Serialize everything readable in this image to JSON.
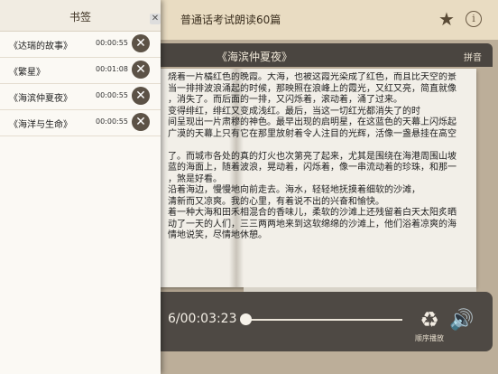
{
  "navbar": {
    "title": "普通话考试朗读60篇",
    "star_icon": "star-icon",
    "info_icon": "info-icon",
    "info_glyph": "i"
  },
  "book": {
    "title": "《海滨仲夏夜》",
    "pinyin_label": "拼音",
    "lines": [
      "烧着一片橘红色的晚霞。大海，也被这霞光染成了红色，而且比天空的景",
      "当一排排波浪涌起的时候，那映照在浪峰上的霞光，又红又亮，简直就像",
      "，消失了。而后面的一排，又闪烁着，滚动着，涌了过来。",
      "变得绯红，绯红又变成浅红。最后，当这一切红光都消失了的时",
      "间呈现出一片肃穆的神色。最早出现的启明星，在这蓝色的天幕上闪烁起",
      "广漠的天幕上只有它在那里放射着令人注目的光辉，活像一盏悬挂在高空",
      "",
      "了。而城市各处的真的灯火也次第亮了起来，尤其是围绕在海港周围山坡",
      "蓝的海面上，随着波浪，晃动着，闪烁着，像一串流动着的珍珠，和那一",
      "，煞是好看。",
      "沿着海边，慢慢地向前走去。海水，轻轻地抚摸着细软的沙滩，",
      "清新而又凉爽。我的心里，有着说不出的兴奋和愉快。",
      "着一种大海和田禾相混合的香味儿，柔软的沙滩上还残留着白天太阳炙晒",
      "动了一天的人们，三三两两地来到这软绵绵的沙滩上，他们浴着凉爽的海",
      "情地说笑，尽情地休憩。"
    ]
  },
  "player": {
    "time": "6/00:03:23",
    "progress": 0.0,
    "mode_label": "顺序播放",
    "recycle_icon": "recycle-icon",
    "volume_icon": "volume-icon"
  },
  "bookmarks": {
    "title": "书签",
    "close_glyph": "✕",
    "items": [
      {
        "name": "《达瑞的故事》",
        "time": "00:00:55"
      },
      {
        "name": "《繁星》",
        "time": "00:01:08"
      },
      {
        "name": "《海滨仲夏夜》",
        "time": "00:00:55"
      },
      {
        "name": "《海洋与生命》",
        "time": "00:00:55"
      }
    ]
  }
}
